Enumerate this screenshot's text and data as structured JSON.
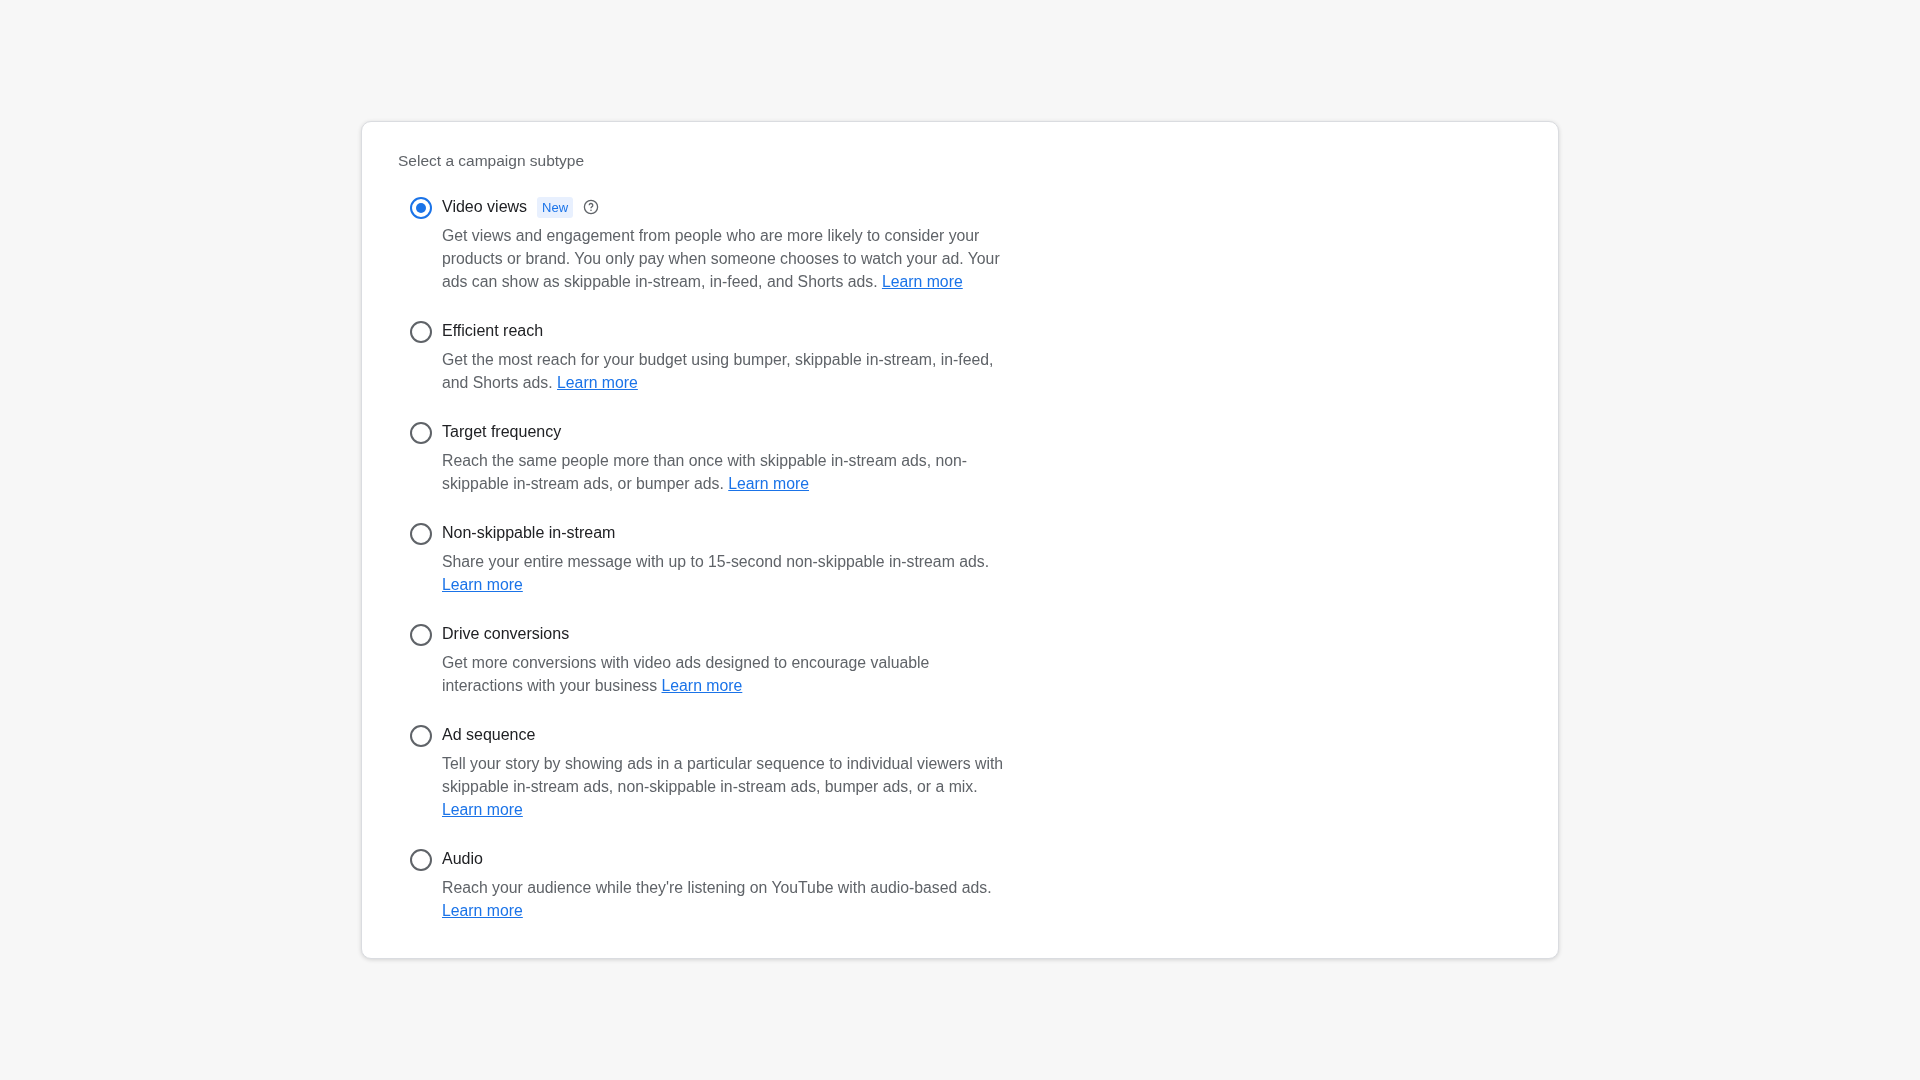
{
  "panel": {
    "title": "Select a campaign subtype",
    "options": [
      {
        "label": "Video views",
        "selected": true,
        "badge": "New",
        "help": true,
        "description": "Get views and engagement from people who are more likely to consider your products or brand. You only pay when someone chooses to watch your ad. Your ads can show as skippable in-stream, in-feed, and Shorts ads.",
        "link": "Learn more"
      },
      {
        "label": "Efficient reach",
        "selected": false,
        "description": "Get the most reach for your budget using bumper, skippable in-stream, in-feed, and Shorts ads.",
        "link": "Learn more"
      },
      {
        "label": "Target frequency",
        "selected": false,
        "description": "Reach the same people more than once with skippable in-stream ads, non-skippable in-stream ads, or bumper ads.",
        "link": "Learn more"
      },
      {
        "label": "Non-skippable in-stream",
        "selected": false,
        "description": "Share your entire message with up to 15-second non-skippable in-stream ads.",
        "link": "Learn more"
      },
      {
        "label": "Drive conversions",
        "selected": false,
        "description": "Get more conversions with video ads designed to encourage valuable interactions with your business",
        "link": "Learn more"
      },
      {
        "label": "Ad sequence",
        "selected": false,
        "description": "Tell your story by showing ads in a particular sequence to individual viewers with skippable in-stream ads, non-skippable in-stream ads, bumper ads, or a mix.",
        "link": "Learn more"
      },
      {
        "label": "Audio",
        "selected": false,
        "description": "Reach your audience while they're listening on YouTube with audio-based ads.",
        "link": "Learn more"
      }
    ]
  }
}
